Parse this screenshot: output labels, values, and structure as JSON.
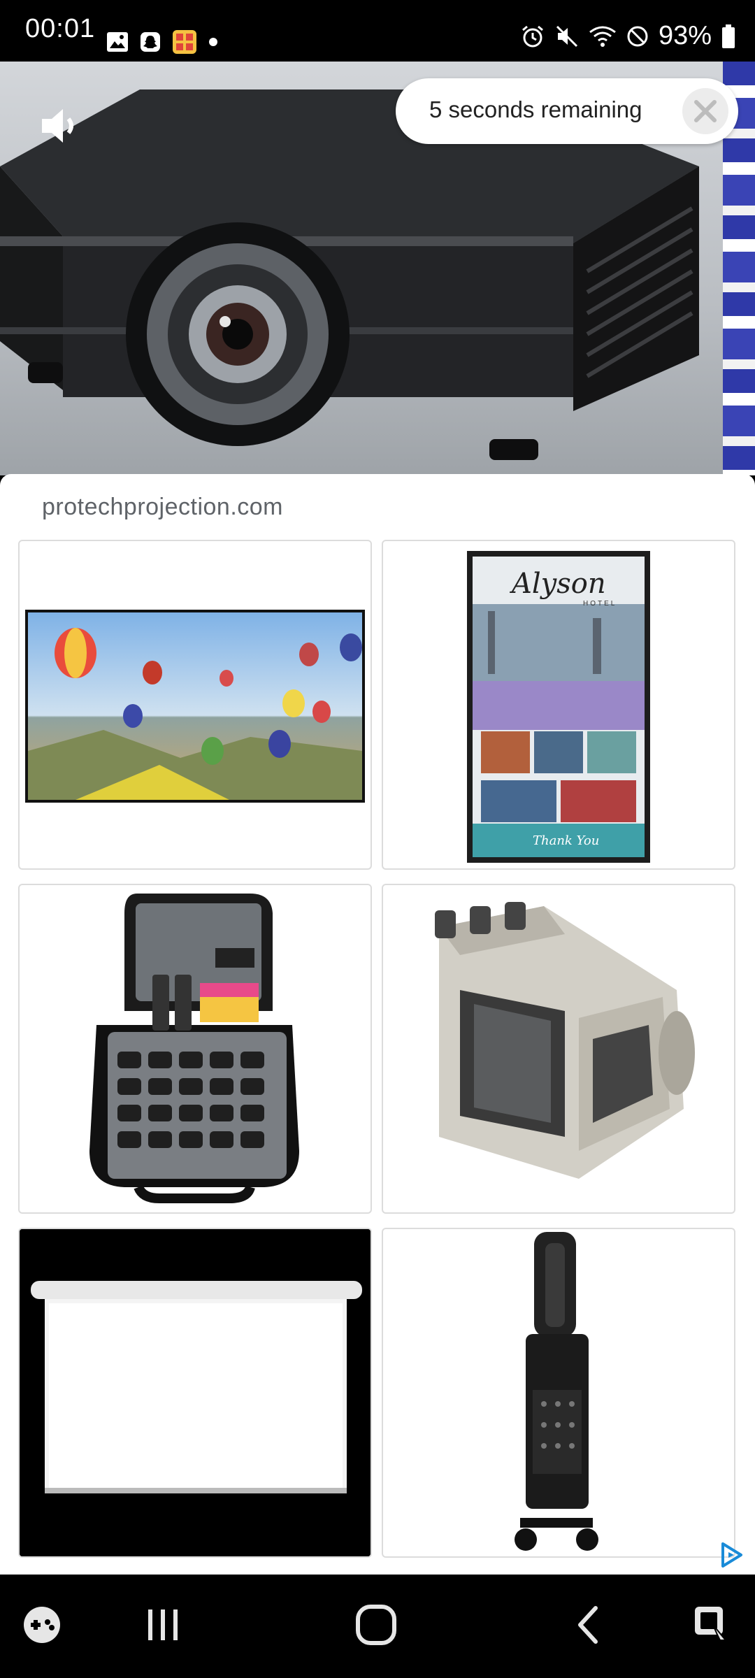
{
  "status_bar": {
    "time": "00:01",
    "battery_percent": "93%",
    "left_icons": [
      "gallery-icon",
      "snapchat-icon",
      "game-app-icon",
      "notification-dot-icon"
    ],
    "right_icons": [
      "alarm-icon",
      "mute-icon",
      "wifi-icon",
      "do-not-disturb-icon",
      "battery-icon"
    ]
  },
  "ad": {
    "timer_text": "5 seconds remaining",
    "domain": "protechprojection.com",
    "products": [
      {
        "name": "hot-air-balloon-display-screen"
      },
      {
        "name": "alyson-hotel-digital-signage"
      },
      {
        "name": "projector-carry-case"
      },
      {
        "name": "projector-lamp-module"
      },
      {
        "name": "projection-screen"
      },
      {
        "name": "portable-speaker-trolley"
      }
    ],
    "poster": {
      "title": "Alyson",
      "subtitle": "HOTEL",
      "footer": "Thank You"
    }
  },
  "nav_bar": {
    "items": [
      "game-launcher-icon",
      "recent-apps-icon",
      "home-icon",
      "back-icon",
      "keyboard-icon"
    ]
  }
}
